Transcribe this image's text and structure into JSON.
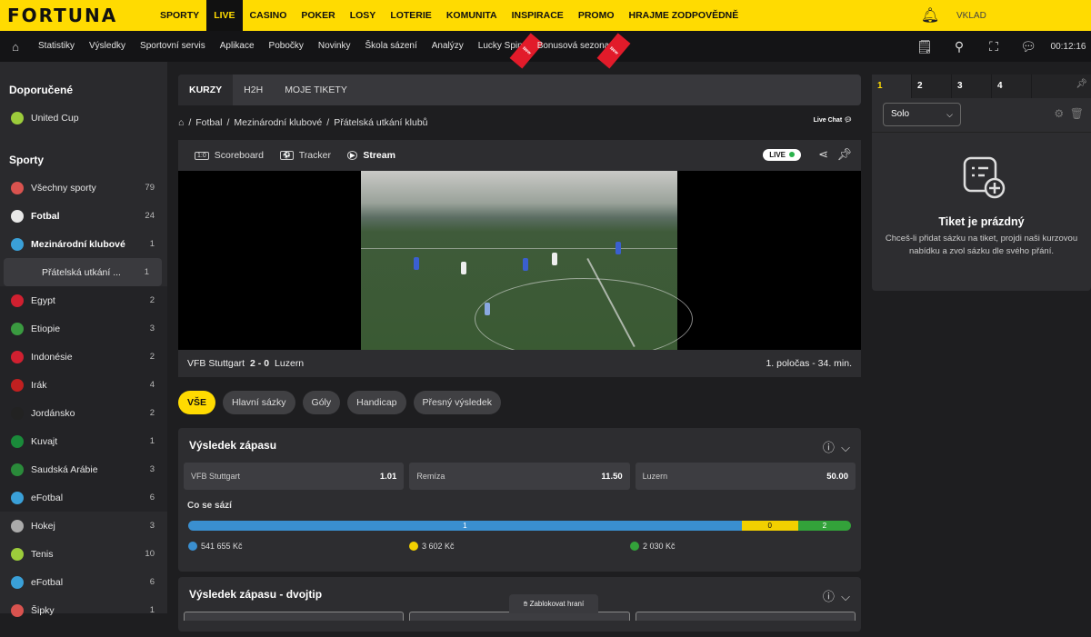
{
  "brand": {
    "logo": "FORTUNA",
    "accent": "#ffdb01"
  },
  "topnav": [
    {
      "label": "SPORTY"
    },
    {
      "label": "LIVE",
      "active": true
    },
    {
      "label": "CASINO"
    },
    {
      "label": "POKER"
    },
    {
      "label": "LOSY"
    },
    {
      "label": "LOTERIE"
    },
    {
      "label": "KOMUNITA"
    },
    {
      "label": "INSPIRACE"
    },
    {
      "label": "PROMO"
    },
    {
      "label": "HRAJME ZODPOVĚDNĚ"
    }
  ],
  "topright": {
    "deposit": "VKLAD",
    "icon": "bell-icon"
  },
  "subnav": [
    {
      "label": "Statistiky"
    },
    {
      "label": "Výsledky"
    },
    {
      "label": "Sportovní servis"
    },
    {
      "label": "Aplikace"
    },
    {
      "label": "Pobočky"
    },
    {
      "label": "Novinky"
    },
    {
      "label": "Škola sázení"
    },
    {
      "label": "Analýzy"
    },
    {
      "label": "Lucky Spin",
      "badge": "New"
    },
    {
      "label": "Bonusová sezona",
      "badge": "New"
    }
  ],
  "clock": "00:12:16",
  "sidebar": {
    "recommended_title": "Doporučené",
    "recommended": [
      {
        "label": "United Cup",
        "color": "#9ccc3b"
      }
    ],
    "sports_title": "Sporty",
    "items": [
      {
        "label": "Všechny sporty",
        "count": "79",
        "color": "#d9534f"
      },
      {
        "label": "Fotbal",
        "count": "24",
        "color": "#e8e8e8"
      },
      {
        "label": "Mezinárodní klubové",
        "count": "1",
        "color": "#3aa0d8"
      },
      {
        "label": "Přátelská utkání ...",
        "count": "1",
        "color": "none"
      },
      {
        "label": "Egypt",
        "count": "2",
        "color": "#d02030"
      },
      {
        "label": "Etiopie",
        "count": "3",
        "color": "#3a9a40"
      },
      {
        "label": "Indonésie",
        "count": "2",
        "color": "#d02030"
      },
      {
        "label": "Irák",
        "count": "4",
        "color": "#c02020"
      },
      {
        "label": "Jordánsko",
        "count": "2",
        "color": "#222222"
      },
      {
        "label": "Kuvajt",
        "count": "1",
        "color": "#1a8a3a"
      },
      {
        "label": "Saudská Arábie",
        "count": "3",
        "color": "#2a8a3a"
      },
      {
        "label": "eFotbal",
        "count": "6",
        "color": "#3aa0d8"
      },
      {
        "label": "Hokej",
        "count": "3",
        "color": "#aaaaaa"
      },
      {
        "label": "Tenis",
        "count": "10",
        "color": "#9ccc3b"
      },
      {
        "label": "eFotbal",
        "count": "6",
        "color": "#3aa0d8"
      },
      {
        "label": "Šipky",
        "count": "1",
        "color": "#d9534f"
      }
    ]
  },
  "tabs": [
    {
      "label": "KURZY",
      "active": true
    },
    {
      "label": "H2H"
    },
    {
      "label": "MOJE TIKETY"
    }
  ],
  "breadcrumb": [
    "Fotbal",
    "Mezinárodní klubové",
    "Přátelská utkání klubů"
  ],
  "live_chat": "Live Chat",
  "stream_tabs": [
    {
      "label": "Scoreboard",
      "icon": "1:0"
    },
    {
      "label": "Tracker",
      "icon": "⚽"
    },
    {
      "label": "Stream",
      "icon": "▶",
      "active": true
    }
  ],
  "live_badge": "LIVE",
  "match": {
    "home": "VFB Stuttgart",
    "score": "2 - 0",
    "away": "Luzern",
    "period": "1. poločas - 34. min."
  },
  "filters": [
    {
      "label": "VŠE",
      "active": true
    },
    {
      "label": "Hlavní sázky"
    },
    {
      "label": "Góly"
    },
    {
      "label": "Handicap"
    },
    {
      "label": "Přesný výsledek"
    }
  ],
  "market1": {
    "title": "Výsledek zápasu",
    "odds": [
      {
        "label": "VFB Stuttgart",
        "value": "1.01"
      },
      {
        "label": "Remíza",
        "value": "11.50"
      },
      {
        "label": "Luzern",
        "value": "50.00"
      }
    ],
    "co_se_sazi": "Co se sází",
    "split": [
      {
        "label": "1",
        "fraction": 0.835,
        "color": "#3a8fd0"
      },
      {
        "label": "0",
        "fraction": 0.085,
        "color": "#f2d000"
      },
      {
        "label": "2",
        "fraction": 0.08,
        "color": "#33a23a"
      }
    ],
    "stakes": [
      {
        "amount": "541 655 Kč",
        "color": "#3a8fd0"
      },
      {
        "amount": "3 602 Kč",
        "color": "#f2d000"
      },
      {
        "amount": "2 030 Kč",
        "color": "#33a23a"
      }
    ]
  },
  "market2": {
    "title": "Výsledek zápasu - dvojtip"
  },
  "block_btn": "Zablokovat hraní",
  "ticket": {
    "tabs": [
      "1",
      "2",
      "3",
      "4"
    ],
    "select": "Solo",
    "title": "Tiket je prázdný",
    "desc": "Chceš-li přidat sázku na tiket, projdi naši kurzovou nabídku a zvol sázku dle svého přání."
  }
}
